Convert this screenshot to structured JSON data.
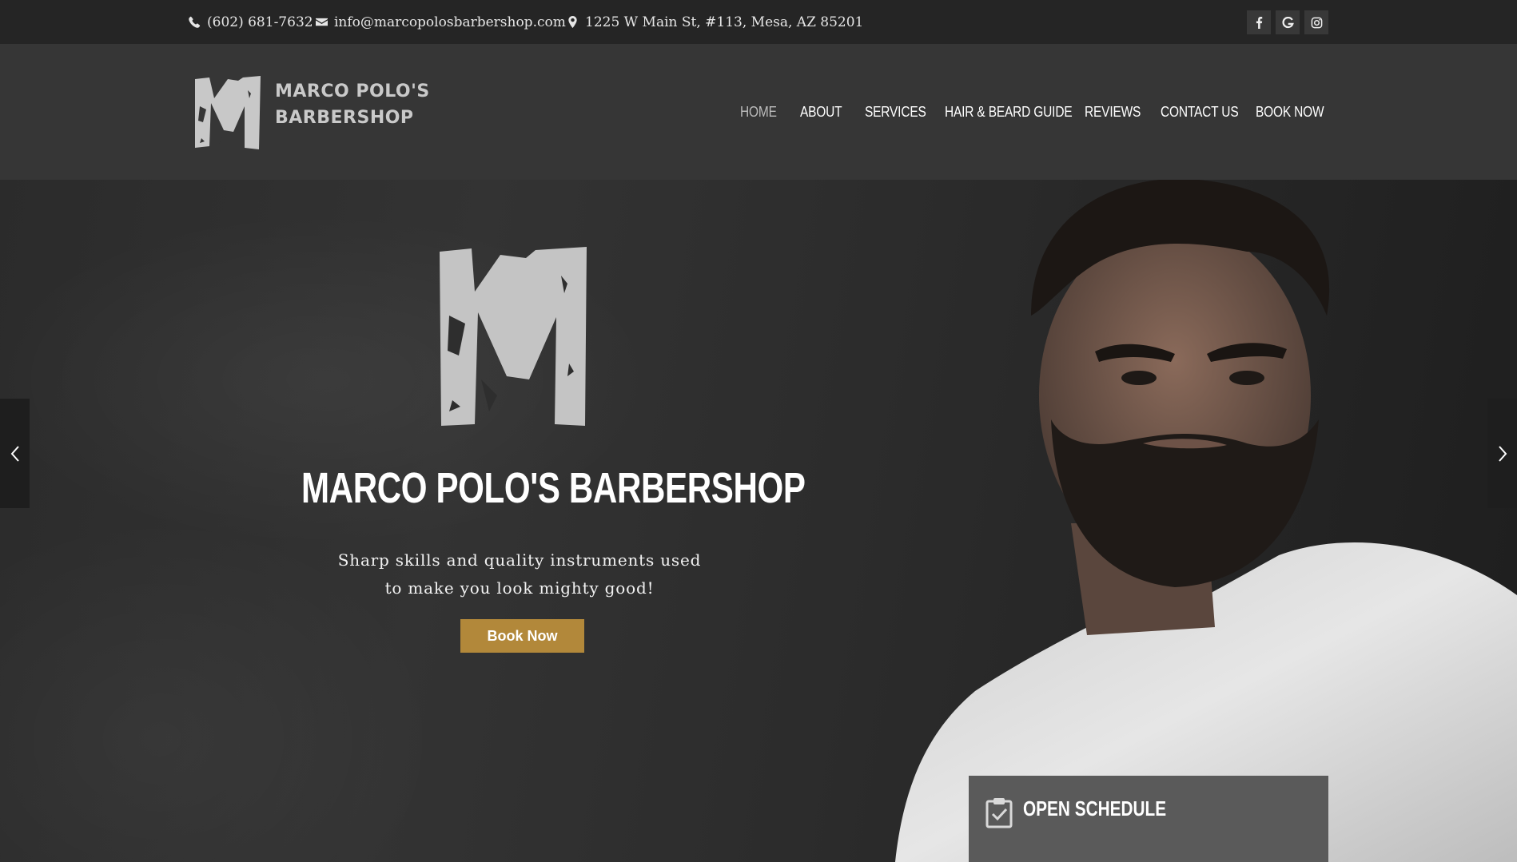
{
  "topbar": {
    "phone": "(602) 681-7632",
    "email": "info@marcopolosbarbershop.com",
    "address": "1225 W Main St, #113, Mesa, AZ 85201",
    "social": [
      "facebook-icon",
      "google-icon",
      "instagram-icon"
    ]
  },
  "header": {
    "logo_line1": "MARCO POLO'S",
    "logo_line2": "BARBERSHOP",
    "nav": {
      "home": "HOME",
      "about": "ABOUT",
      "services": "SERVICES",
      "guide": "HAIR & BEARD GUIDE",
      "reviews": "REVIEWS",
      "contact": "CONTACT US",
      "book": "BOOK NOW"
    }
  },
  "hero": {
    "title": "MARCO POLO'S BARBERSHOP",
    "subtitle_line1": "Sharp skills and quality instruments used",
    "subtitle_line2": "to make you look mighty good!",
    "button": "Book Now"
  },
  "schedule": {
    "label": "OPEN SCHEDULE"
  },
  "colors": {
    "accent": "#b2883a",
    "topbar_bg": "#252525",
    "header_bg": "#363636",
    "schedule_bg": "#5a5a5a"
  }
}
